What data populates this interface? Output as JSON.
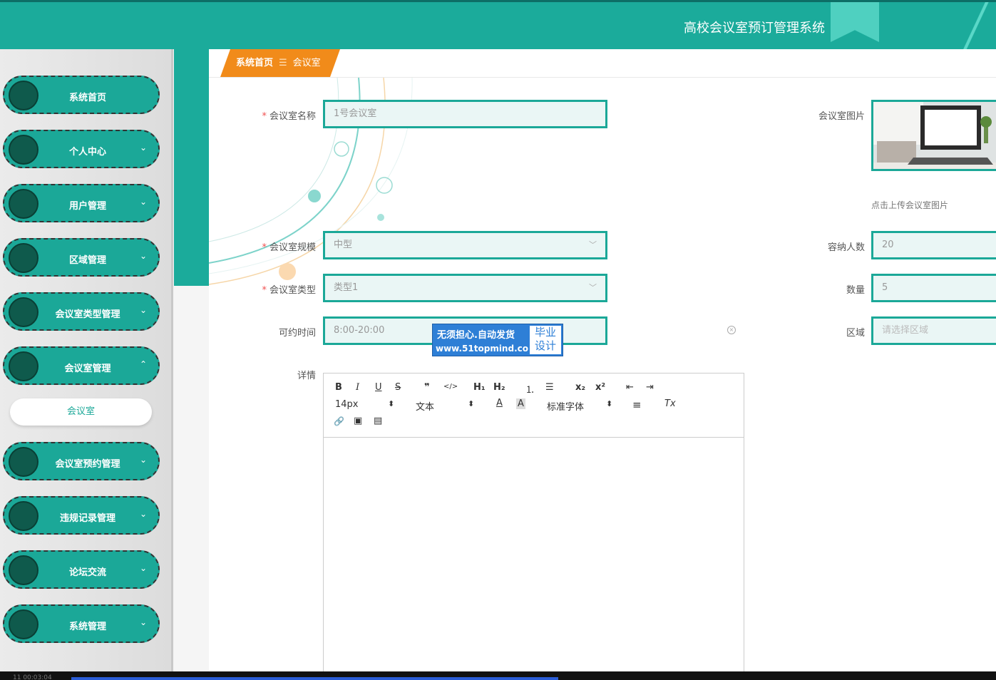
{
  "header": {
    "title": "高校会议室预订管理系统"
  },
  "sidebar": {
    "items": [
      {
        "label": "系统首页",
        "chevron": ""
      },
      {
        "label": "个人中心",
        "chevron": "⌄"
      },
      {
        "label": "用户管理",
        "chevron": "⌄"
      },
      {
        "label": "区域管理",
        "chevron": "⌄"
      },
      {
        "label": "会议室类型管理",
        "chevron": "⌄"
      },
      {
        "label": "会议室管理",
        "chevron": "⌃"
      },
      {
        "label": "会议室预约管理",
        "chevron": "⌄"
      },
      {
        "label": "违规记录管理",
        "chevron": "⌄"
      },
      {
        "label": "论坛交流",
        "chevron": "⌄"
      },
      {
        "label": "系统管理",
        "chevron": "⌄"
      }
    ],
    "subitem": "会议室"
  },
  "breadcrumb": {
    "home": "系统首页",
    "separator": "☰",
    "current": "会议室"
  },
  "form": {
    "name_label": "会议室名称",
    "name_value": "1号会议室",
    "image_label": "会议室图片",
    "upload_hint": "点击上传会议室图片",
    "scale_label": "会议室规模",
    "scale_value": "中型",
    "capacity_label": "容纳人数",
    "capacity_value": "20",
    "type_label": "会议室类型",
    "type_value": "类型1",
    "count_label": "数量",
    "count_value": "5",
    "time_label": "可约时间",
    "time_value": "8:00-20:00",
    "area_label": "区域",
    "area_placeholder": "请选择区域",
    "detail_label": "详情",
    "required_mark": "*"
  },
  "editor": {
    "bold": "B",
    "italic": "I",
    "underline": "U",
    "strike": "S",
    "quote": "❞",
    "code": "</>",
    "h1": "H₁",
    "h2": "H₂",
    "ol": "⒈",
    "ul": "☰",
    "sub": "x₂",
    "sup": "x²",
    "outdent": "⇤",
    "indent": "⇥",
    "size": "14px",
    "size_arrows": "⬍",
    "text_type": "文本",
    "type_arrows": "⬍",
    "color": "A",
    "bg_color": "A",
    "font": "标准字体",
    "font_arrows": "⬍",
    "align": "≡",
    "clear": "Tx",
    "link": "🔗",
    "image": "▣",
    "video": "▤"
  },
  "watermark": {
    "line1": "无须担心.自动发货",
    "line2": "www.51topmind.com",
    "box_line1": "毕业",
    "box_line2": "设计"
  },
  "player": {
    "time": "11  00:03:04"
  },
  "colors": {
    "primary": "#1bab9b",
    "accent": "#f18b1a",
    "dark_knob": "#0f5a4c"
  }
}
